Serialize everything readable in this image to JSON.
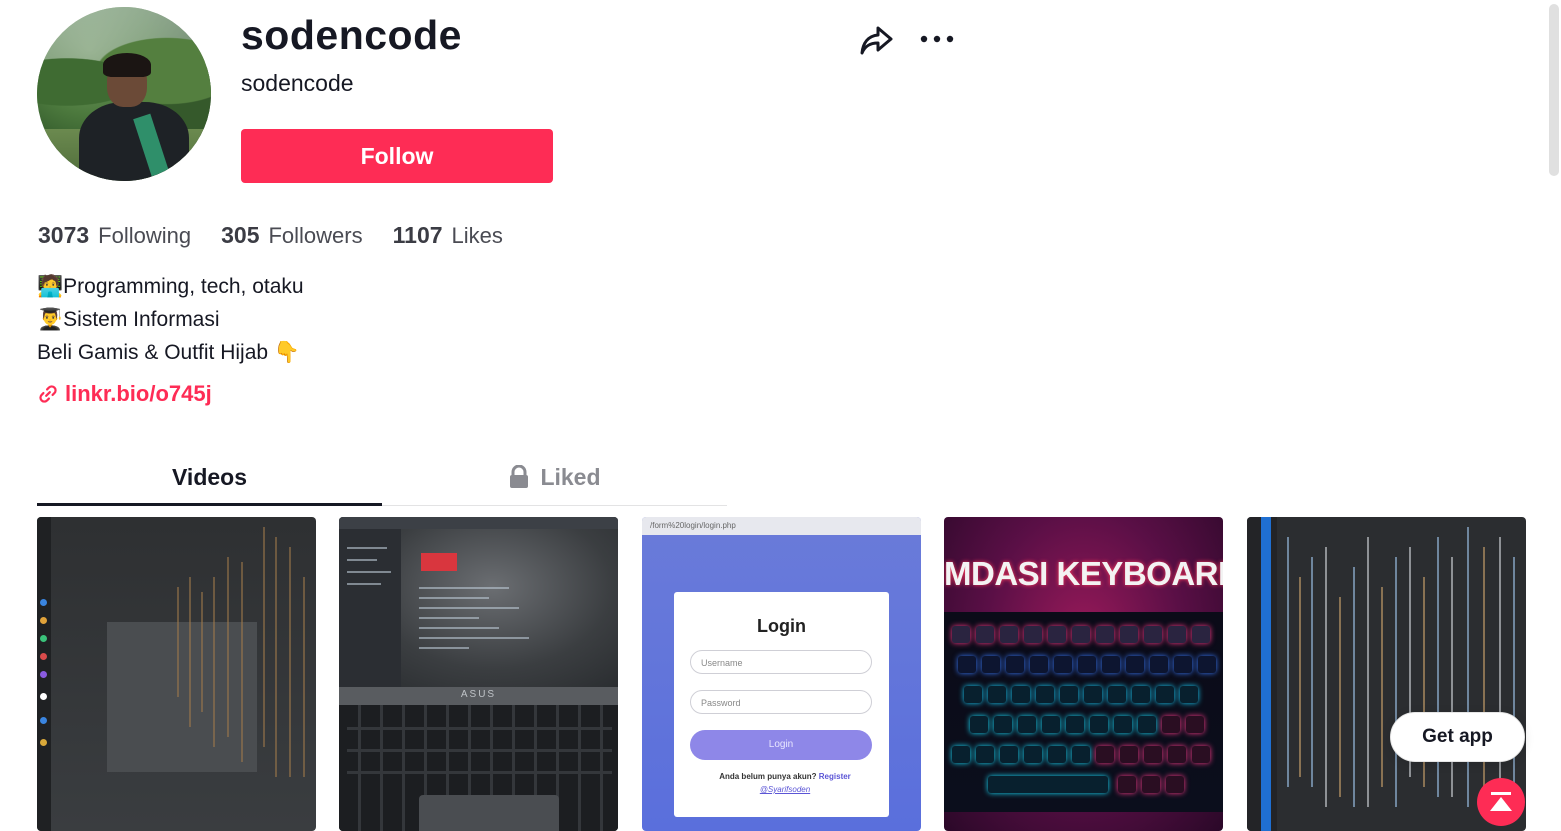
{
  "profile": {
    "display_name": "sodencode",
    "username": "sodencode",
    "follow_label": "Follow",
    "avatar_alt": "profile photo"
  },
  "actions": {
    "share_icon": "share-icon",
    "more_icon": "more-icon"
  },
  "stats": [
    {
      "value": "3073",
      "label": "Following"
    },
    {
      "value": "305",
      "label": "Followers"
    },
    {
      "value": "1107",
      "label": "Likes"
    }
  ],
  "bio": {
    "line1_emoji": "🧑‍💻",
    "line1_text": "Programming, tech, otaku",
    "line2_emoji": "👨‍🎓",
    "line2_text": "Sistem Informasi",
    "line3_text": "Beli Gamis & Outfit Hijab",
    "line3_emoji": "👇",
    "link": "linkr.bio/o745j"
  },
  "tabs": [
    {
      "label": "Videos",
      "active": true
    },
    {
      "label": "Liked",
      "locked": true
    }
  ],
  "videos": [
    {
      "title": ""
    },
    {
      "title": "",
      "brand": "ASUS"
    },
    {
      "title": "",
      "url": "/form%20login/login.php",
      "login_title": "Login",
      "username_placeholder": "Username",
      "password_placeholder": "Password",
      "login_button": "Login",
      "note": "Anda belum punya akun?",
      "register": "Register",
      "byline": "@Syarifsoden"
    },
    {
      "title": "MDASI KEYBOARD"
    },
    {
      "title": ""
    }
  ],
  "floating": {
    "get_app_label": "Get app",
    "scroll_top_icon": "scroll-to-top-icon"
  },
  "colors": {
    "accent": "#fe2c55",
    "text": "#161823",
    "muted": "#8a8b91"
  }
}
